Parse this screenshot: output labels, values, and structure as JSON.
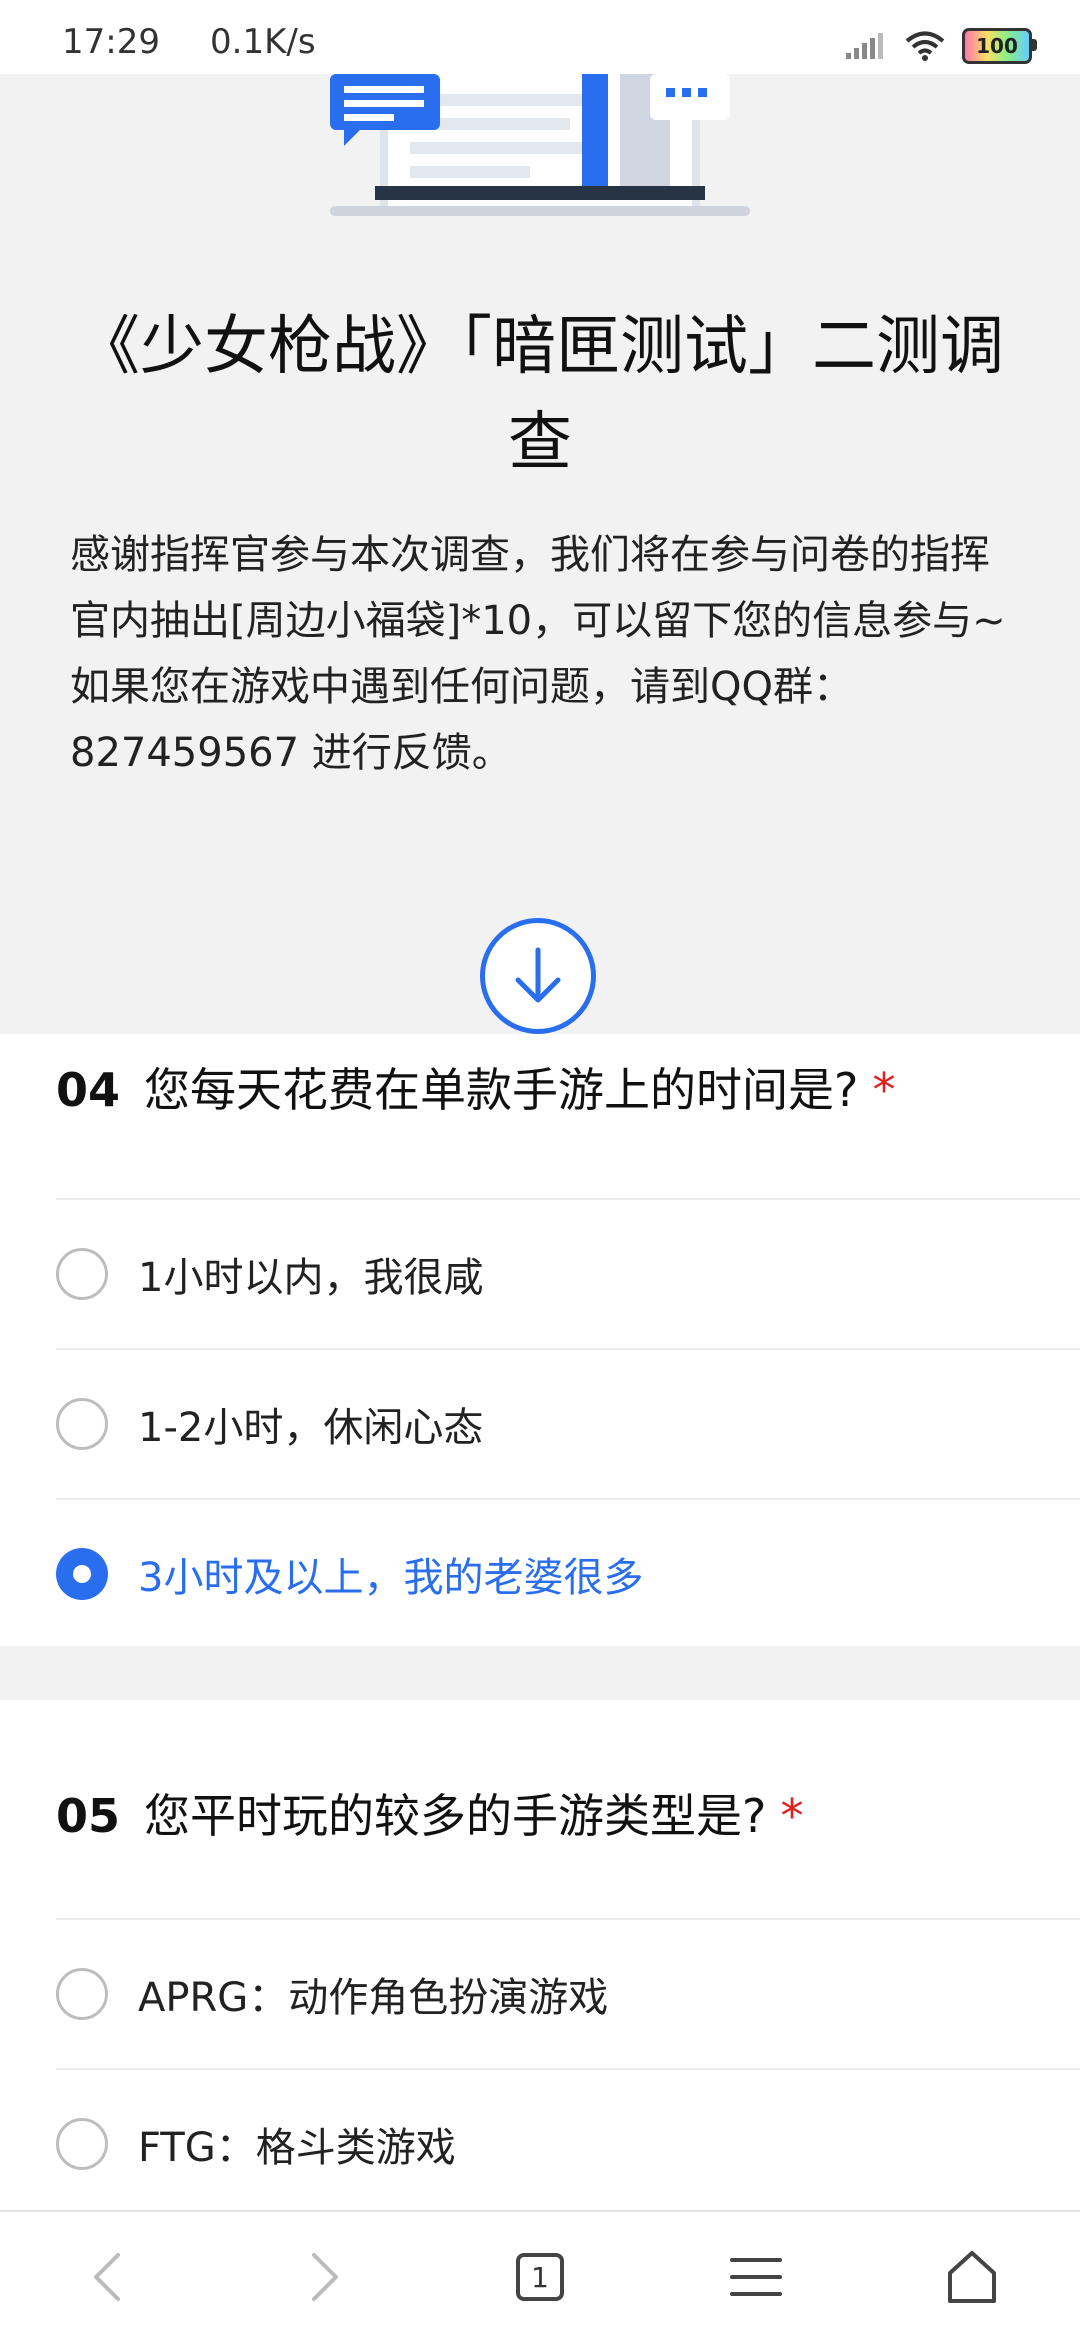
{
  "status_bar": {
    "time": "17:29",
    "speed": "0.1K/s",
    "battery": "100"
  },
  "survey": {
    "title": "《少女枪战》「暗匣测试」二测调查",
    "description": "感谢指挥官参与本次调查，我们将在参与问卷的指挥官内抽出[周边小福袋]*10，可以留下您的信息参与~如果您在游戏中遇到任何问题，请到QQ群：827459567 进行反馈。"
  },
  "questions": [
    {
      "number": "04",
      "text": "您每天花费在单款手游上的时间是?",
      "required": "*",
      "options": [
        {
          "label": "1小时以内，我很咸",
          "selected": false
        },
        {
          "label": "1-2小时，休闲心态",
          "selected": false
        },
        {
          "label": "3小时及以上，我的老婆很多",
          "selected": true
        }
      ]
    },
    {
      "number": "05",
      "text": "您平时玩的较多的手游类型是?",
      "required": "*",
      "options": [
        {
          "label": "APRG：动作角色扮演游戏",
          "selected": false
        },
        {
          "label": "FTG：格斗类游戏",
          "selected": false
        }
      ]
    }
  ],
  "bottom_nav": {
    "tab_count": "1"
  },
  "colors": {
    "accent": "#2a6ef0",
    "required": "#e02020",
    "hero_bg": "#f2f2f2"
  }
}
